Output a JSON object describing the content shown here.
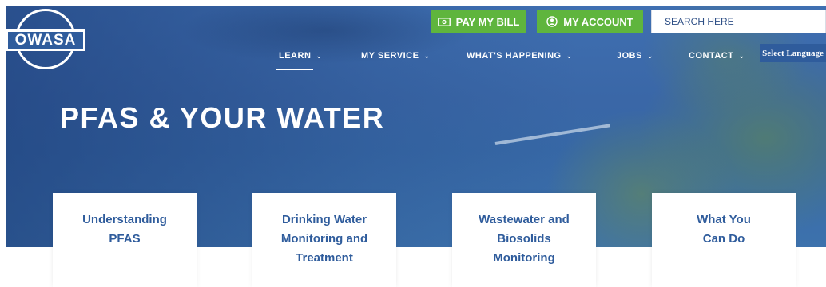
{
  "brand": {
    "logo_text": "OWASA"
  },
  "header": {
    "pay_bill_label": "PAY MY BILL",
    "my_account_label": "MY ACCOUNT",
    "search_placeholder": "SEARCH HERE",
    "select_language_label": "Select Language"
  },
  "nav": {
    "items": [
      {
        "label": "LEARN",
        "active": true
      },
      {
        "label": "MY SERVICE"
      },
      {
        "label": "WHAT'S HAPPENING"
      },
      {
        "label": "JOBS"
      },
      {
        "label": "CONTACT"
      }
    ],
    "chevron": "⌄"
  },
  "hero": {
    "title": "PFAS & YOUR WATER"
  },
  "cards": [
    {
      "label": "Understanding PFAS"
    },
    {
      "label": "Drinking Water Monitoring and Treatment"
    },
    {
      "label": "Wastewater and Biosolids Monitoring"
    },
    {
      "label": "What You Can Do"
    }
  ],
  "colors": {
    "primary_blue": "#2f5c9c",
    "action_green": "#5fb53d"
  },
  "icons": {
    "pay_bill": "money-bill-icon",
    "my_account": "user-circle-icon",
    "nav_dropdown": "chevron-down-icon"
  }
}
